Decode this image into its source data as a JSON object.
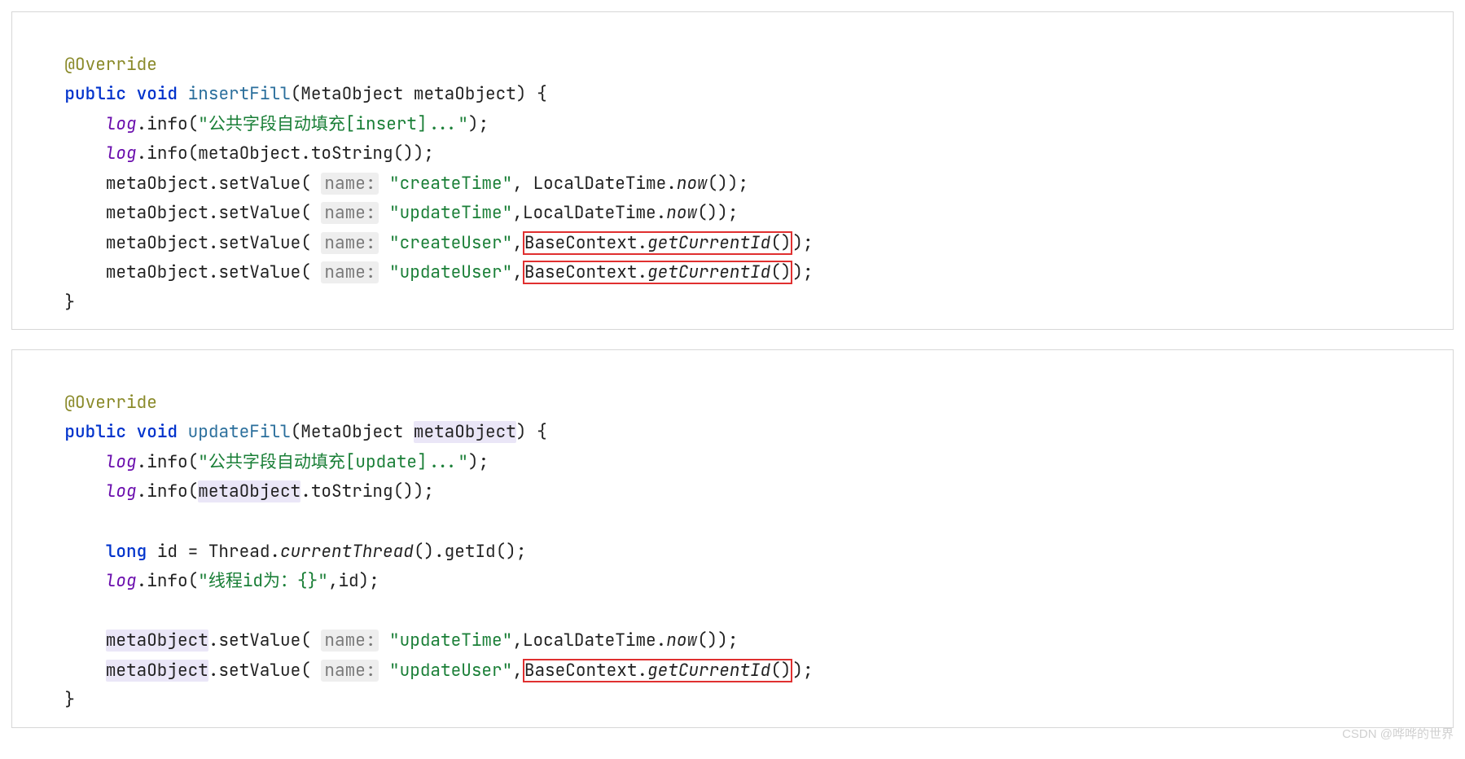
{
  "block1": {
    "annotation": "@Override",
    "kw_public": "public",
    "kw_void": "void",
    "method": "insertFill",
    "paramType": "MetaObject",
    "paramName": "metaObject",
    "brace_open": " {",
    "logField": "log",
    "info": ".info(",
    "str1": "\"公共字段自动填充[insert]...\"",
    "close_paren_semi": ");",
    "toStringCall": ".toString());",
    "setValue": ".setValue(",
    "hint_name": "name:",
    "str_createTime": "\"createTime\"",
    "str_updateTime": "\"updateTime\"",
    "str_createUser": "\"createUser\"",
    "str_updateUser": "\"updateUser\"",
    "comma_sp": ", ",
    "comma": ",",
    "localDateTime": "LocalDateTime.",
    "now": "now",
    "empty_call": "());",
    "baseContext": "BaseContext.",
    "getCurrentId": "getCurrentId",
    "paren_pair": "()",
    "brace_close": "}",
    "space1": "    ",
    "space2": "        "
  },
  "block2": {
    "annotation": "@Override",
    "kw_public": "public",
    "kw_void": "void",
    "method": "updateFill",
    "paramType": "MetaObject",
    "paramName": "metaObject",
    "brace_open": " {",
    "logField": "log",
    "info": ".info(",
    "str1": "\"公共字段自动填充[update]...\"",
    "close_paren_semi": ");",
    "toStringCall": ".toString());",
    "kw_long": "long",
    "id_decl": " id = Thread.",
    "currentThread": "currentThread",
    "getId_tail": "().getId();",
    "str_thread": "\"线程id为：{}\"",
    "id_arg": ",id);",
    "metaObject": "metaObject",
    "setValue": ".setValue(",
    "hint_name": "name:",
    "str_updateTime": "\"updateTime\"",
    "str_updateUser": "\"updateUser\"",
    "comma": ",",
    "localDateTime": "LocalDateTime.",
    "now": "now",
    "empty_call": "());",
    "baseContext": "BaseContext.",
    "getCurrentId": "getCurrentId",
    "paren_pair": "()",
    "brace_close": "}",
    "space1": "    ",
    "space2": "        "
  },
  "watermark": "CSDN @哗哗的世界"
}
